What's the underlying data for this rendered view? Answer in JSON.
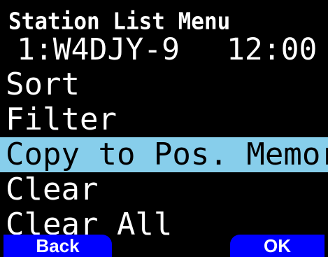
{
  "header": {
    "title": "Station List Menu"
  },
  "station": {
    "id": "1:W4DJY-9",
    "time": "12:00"
  },
  "menu": {
    "items": [
      {
        "label": "Sort",
        "selected": false
      },
      {
        "label": "Filter",
        "selected": false
      },
      {
        "label": "Copy to Pos. Memory",
        "selected": true
      },
      {
        "label": "Clear",
        "selected": false
      },
      {
        "label": "Clear All",
        "selected": false
      }
    ]
  },
  "softkeys": {
    "back_label": "Back",
    "ok_label": "OK"
  },
  "colors": {
    "background": "#000000",
    "text": "#ffffff",
    "highlight": "#87ceeb",
    "softkey": "#0000ff"
  }
}
